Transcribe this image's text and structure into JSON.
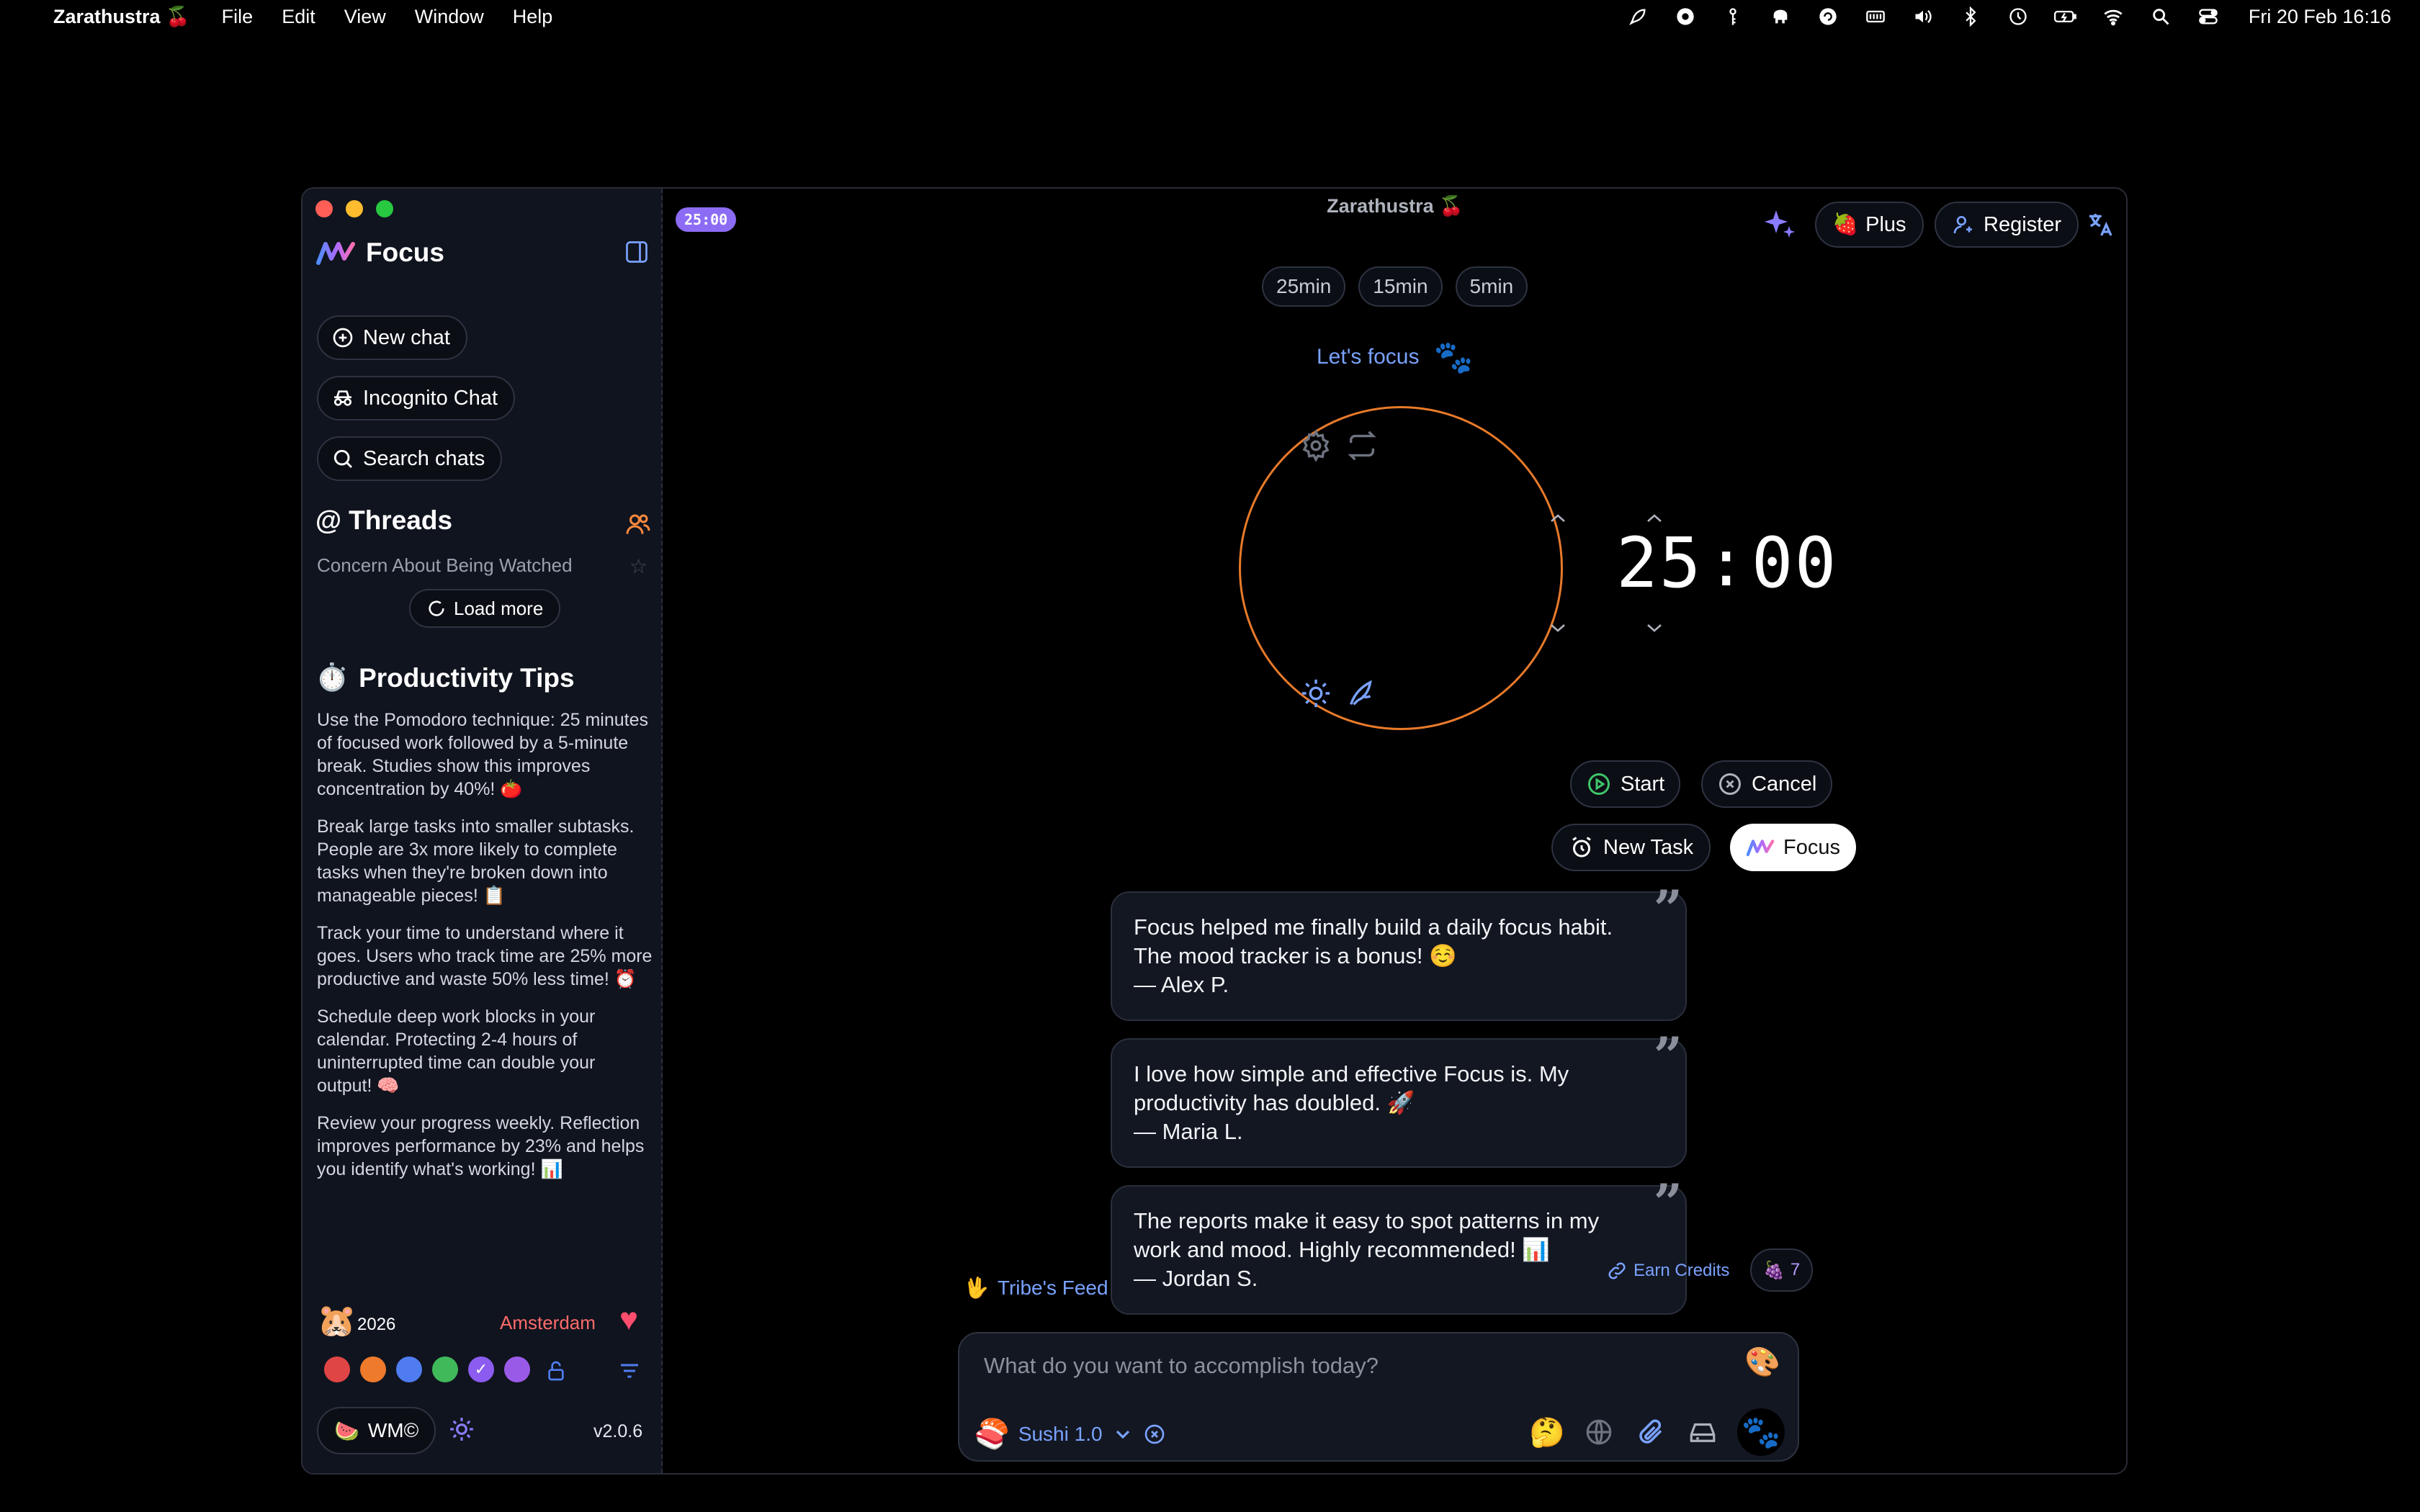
{
  "menubar": {
    "app_name": "Zarathustra 🍒",
    "menus": [
      "File",
      "Edit",
      "View",
      "Window",
      "Help"
    ],
    "clock": "Fri 20 Feb  16:16"
  },
  "window": {
    "title": "Zarathustra 🍒",
    "timer_badge": "25:00"
  },
  "sidebar": {
    "brand": "Focus",
    "new_chat": "New chat",
    "incognito": "Incognito Chat",
    "search": "Search chats",
    "threads_title": "Threads",
    "threads": [
      "Concern About Being Watched"
    ],
    "load_more": "Load more",
    "tips_title": "Productivity Tips",
    "tips": [
      "Use the Pomodoro technique: 25 minutes of focused work followed by a 5-minute break. Studies show this improves concentration by 40%! 🍅",
      "Break large tasks into smaller subtasks. People are 3x more likely to complete tasks when they're broken down into manageable pieces! 📋",
      "Track your time to understand where it goes. Users who track time are 25% more productive and waste 50% less time! ⏰",
      "Schedule deep work blocks in your calendar. Protecting 2-4 hours of uninterrupted time can double your output! 🧠",
      "Review your progress weekly. Reflection improves performance by 23% and helps you identify what's working! 📊"
    ],
    "year": "2026",
    "city": "Amsterdam",
    "wm_label": "WM©",
    "version": "v2.0.6",
    "theme_colors": [
      "#e04545",
      "#ee7a2c",
      "#4f7cf0",
      "#3fb95a",
      "#8c5cf0",
      "#9a5ae8"
    ]
  },
  "header": {
    "plus": "Plus",
    "register": "Register"
  },
  "timer": {
    "presets": [
      "25min",
      "15min",
      "5min"
    ],
    "greeting": "Let's focus",
    "minutes": "25",
    "seconds": "00",
    "start": "Start",
    "cancel": "Cancel",
    "new_task": "New Task",
    "focus": "Focus",
    "ring_color": "#e87a2a"
  },
  "testimonials": [
    {
      "line1": "Focus helped me finally build a daily focus habit.",
      "line2": "The mood tracker is a bonus! ☺️",
      "author": "— Alex P."
    },
    {
      "line1": "I love how simple and effective Focus is. My",
      "line2": "productivity has doubled. 🚀",
      "author": "— Maria L."
    },
    {
      "line1": "The reports make it easy to spot patterns in my",
      "line2": "work and mood. Highly recommended! 📊",
      "author": "— Jordan S."
    }
  ],
  "feed": {
    "tribe": "Tribe's Feed",
    "earn": "Earn Credits",
    "grape_count": "7"
  },
  "composer": {
    "placeholder": "What do you want to accomplish today?",
    "model": "Sushi 1.0"
  }
}
